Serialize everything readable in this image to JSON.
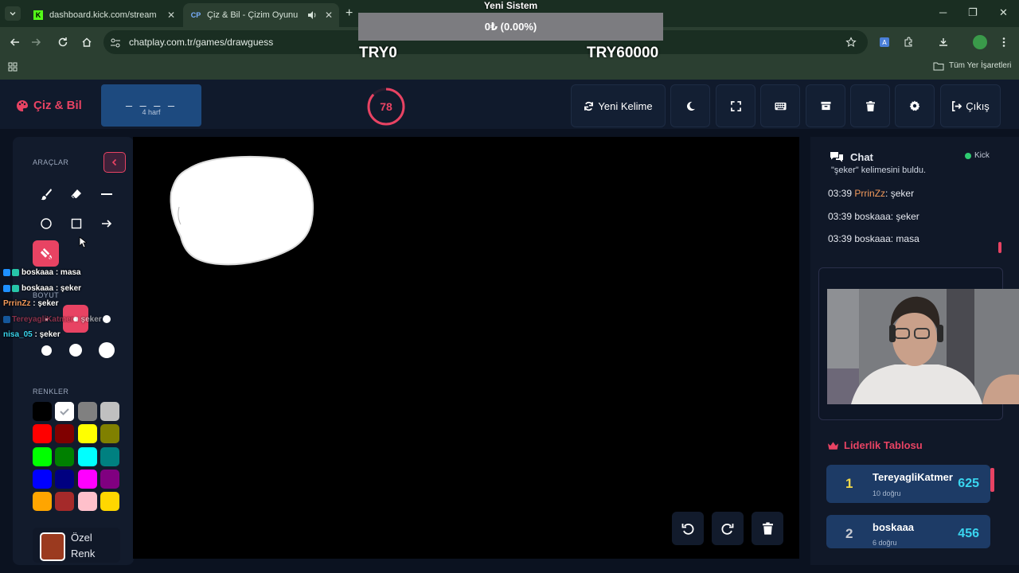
{
  "browser": {
    "tabs": [
      {
        "title": "dashboard.kick.com/stream",
        "favicon": "kick-favicon",
        "active": false
      },
      {
        "title": "Çiz & Bil - Çizim Oyunu",
        "favicon": "chatplay-favicon",
        "active": true
      }
    ],
    "url": "chatplay.com.tr/games/drawguess",
    "bookmarks_label": "Tüm Yer İşaretleri"
  },
  "overlay": {
    "title": "Yeni Sistem",
    "progress_text": "0₺ (0.00%)",
    "progress_fraction": 0.0,
    "min_label": "TRY0",
    "max_label": "TRY60000"
  },
  "header": {
    "logo": "Çiz & Bil",
    "word_mask": "_ _ _ _",
    "word_hint": "4 harf",
    "timer": "78",
    "timer_fraction": 0.87,
    "new_word": "Yeni Kelime",
    "logout": "Çıkış",
    "accent": "#e84363"
  },
  "tools": {
    "section_tools": "ARAÇLAR",
    "section_size": "BOYUT",
    "section_colors": "RENKLER",
    "custom_color_label": "Özel Renk",
    "custom_color": "#9b3a1f",
    "colors": [
      "#000000",
      "#ffffff",
      "#808080",
      "#c0c0c0",
      "#ff0000",
      "#800000",
      "#ffff00",
      "#808000",
      "#00ff00",
      "#008000",
      "#00ffff",
      "#008080",
      "#0000ff",
      "#000080",
      "#ff00ff",
      "#800080",
      "#ffa500",
      "#a52a2a",
      "#ffc0cb",
      "#ffd700"
    ]
  },
  "stream_chat": [
    {
      "user": "boskaaa",
      "text": ": masa"
    },
    {
      "user": "boskaaa",
      "text": ": şeker"
    },
    {
      "user": "PrrinZz",
      "text": ": şeker"
    },
    {
      "user": "TereyagliKatmer",
      "text": ": şeker"
    },
    {
      "user": "nisa_05",
      "text": ": şeker"
    }
  ],
  "chat": {
    "title": "Chat",
    "platform": "Kick",
    "cut_line": "\"şeker\" kelimesini buldu.",
    "messages": [
      {
        "time": "03:39",
        "user": "PrrinZz",
        "text": ": şeker"
      },
      {
        "time": "03:39",
        "user": "boskaaa",
        "text": ": şeker"
      },
      {
        "time": "03:39",
        "user": "boskaaa",
        "text": ": masa"
      }
    ]
  },
  "leaderboard": {
    "title": "Liderlik Tablosu",
    "rows": [
      {
        "rank": "1",
        "name": "TereyagliKatmer",
        "sub": "10 doğru",
        "score": "625"
      },
      {
        "rank": "2",
        "name": "boskaaa",
        "sub": "6 doğru",
        "score": "456"
      }
    ]
  }
}
